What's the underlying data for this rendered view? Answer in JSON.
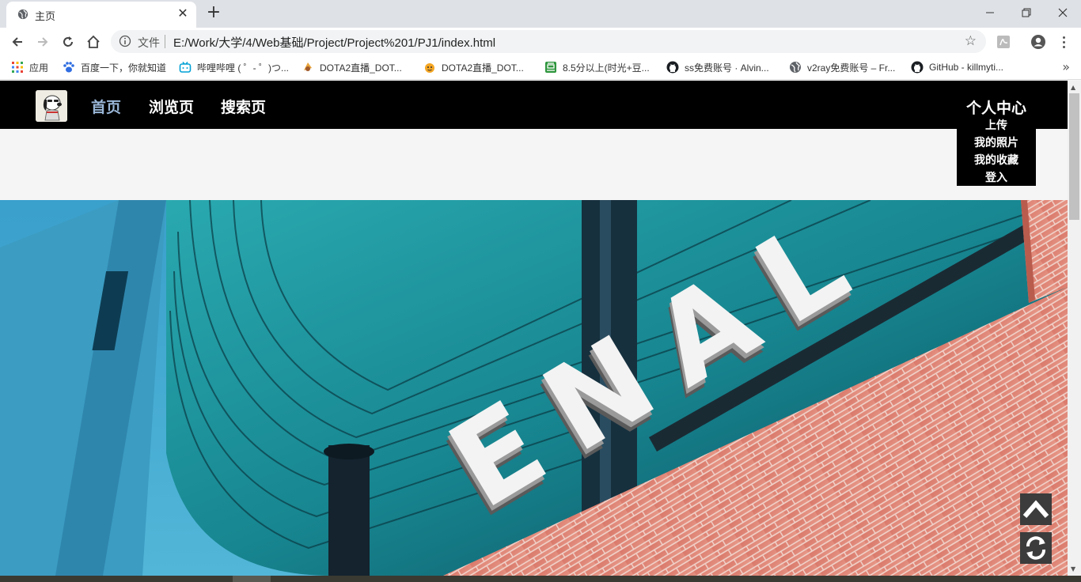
{
  "browser": {
    "tab_title": "主页",
    "new_tab": "+",
    "omnibox": {
      "scheme_label": "文件",
      "url": "E:/Work/大学/4/Web基础/Project/Project%201/PJ1/index.html"
    },
    "bookmarks": [
      {
        "label": "应用",
        "icon": "apps-grid-icon"
      },
      {
        "label": "百度一下，你就知道",
        "icon": "baidu-paw-icon"
      },
      {
        "label": "哔哩哔哩 ( ゜- ゜)つ...",
        "icon": "bilibili-tv-icon"
      },
      {
        "label": "DOTA2直播_DOT...",
        "icon": "douyu-icon"
      },
      {
        "label": "DOTA2直播_DOT...",
        "icon": "huya-icon"
      },
      {
        "label": "8.5分以上(时光+豆...",
        "icon": "douban-icon"
      },
      {
        "label": "ss免费账号 · Alvin...",
        "icon": "github-icon"
      },
      {
        "label": "v2ray免费账号 – Fr...",
        "icon": "globe-icon"
      },
      {
        "label": "GitHub - killmyti...",
        "icon": "github-icon"
      }
    ],
    "bookmarks_more": "»"
  },
  "site": {
    "nav": {
      "home": "首页",
      "browse": "浏览页",
      "search": "搜索页",
      "user_center": "个人中心"
    },
    "user_menu": [
      "上传",
      "我的照片",
      "我的收藏",
      "登入"
    ],
    "hero_image": "building-canopy-photo",
    "hero_text": "ENAL"
  },
  "colors": {
    "navbar_bg": "#000000",
    "nav_active": "#9ab7d8",
    "page_bg": "#f5f5f5"
  }
}
